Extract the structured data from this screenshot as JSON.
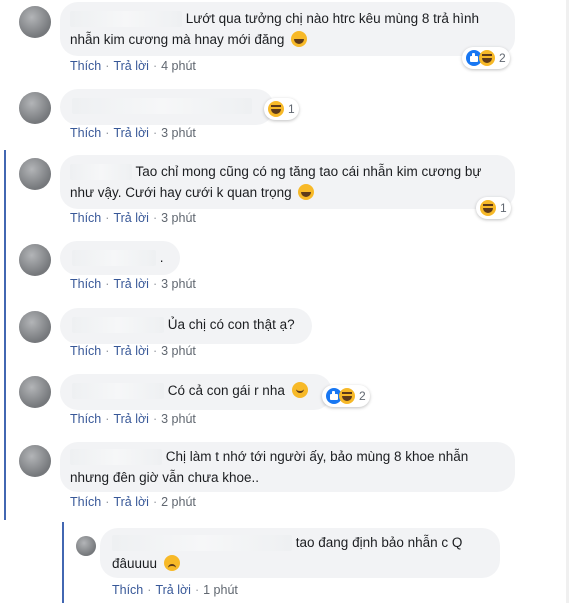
{
  "actions": {
    "like": "Thích",
    "reply": "Trả lời",
    "separator": "·"
  },
  "colors": {
    "link": "#385898",
    "bubble": "#f2f3f5",
    "thread_accent": "#4267b2"
  },
  "comments": [
    {
      "text": "Lướt qua tưởng chị nào htrc kêu mùng 8 trả hình nhẫn kim cương mà hnay mới đăng",
      "emoji": "laugh-emoji",
      "time": "4 phút",
      "reactions": [
        "like",
        "haha"
      ],
      "reaction_count": "2"
    },
    {
      "text": "",
      "emoji": "",
      "time": "3 phút",
      "reactions": [
        "haha"
      ],
      "reaction_count": "1"
    },
    {
      "text": "Tao chỉ mong cũng có ng tăng tao cái nhẫn kim cương bự như vậy. Cưới hay cưới k quan trọng",
      "emoji": "rofl-emoji",
      "time": "3 phút",
      "reactions": [
        "haha"
      ],
      "reaction_count": "1"
    },
    {
      "text": ".",
      "emoji": "",
      "time": "3 phút",
      "reactions": [],
      "reaction_count": ""
    },
    {
      "text": "Ủa chị có con thật ạ?",
      "emoji": "",
      "time": "3 phút",
      "reactions": [],
      "reaction_count": ""
    },
    {
      "text": "Có cả con gái r nha",
      "emoji": "smile-emoji",
      "time": "3 phút",
      "reactions": [
        "like",
        "haha"
      ],
      "reaction_count": "2"
    },
    {
      "text": "Chị làm t nhớ tới người ấy, bảo mùng 8 khoe nhẫn nhưng đên giờ vẫn chưa khoe..",
      "emoji": "",
      "time": "2 phút",
      "reactions": [],
      "reaction_count": ""
    }
  ],
  "reply": {
    "text": "tao đang định bảo nhẫn c Q đâuuuu",
    "emoji": "sad-emoji",
    "time": "1 phút"
  }
}
